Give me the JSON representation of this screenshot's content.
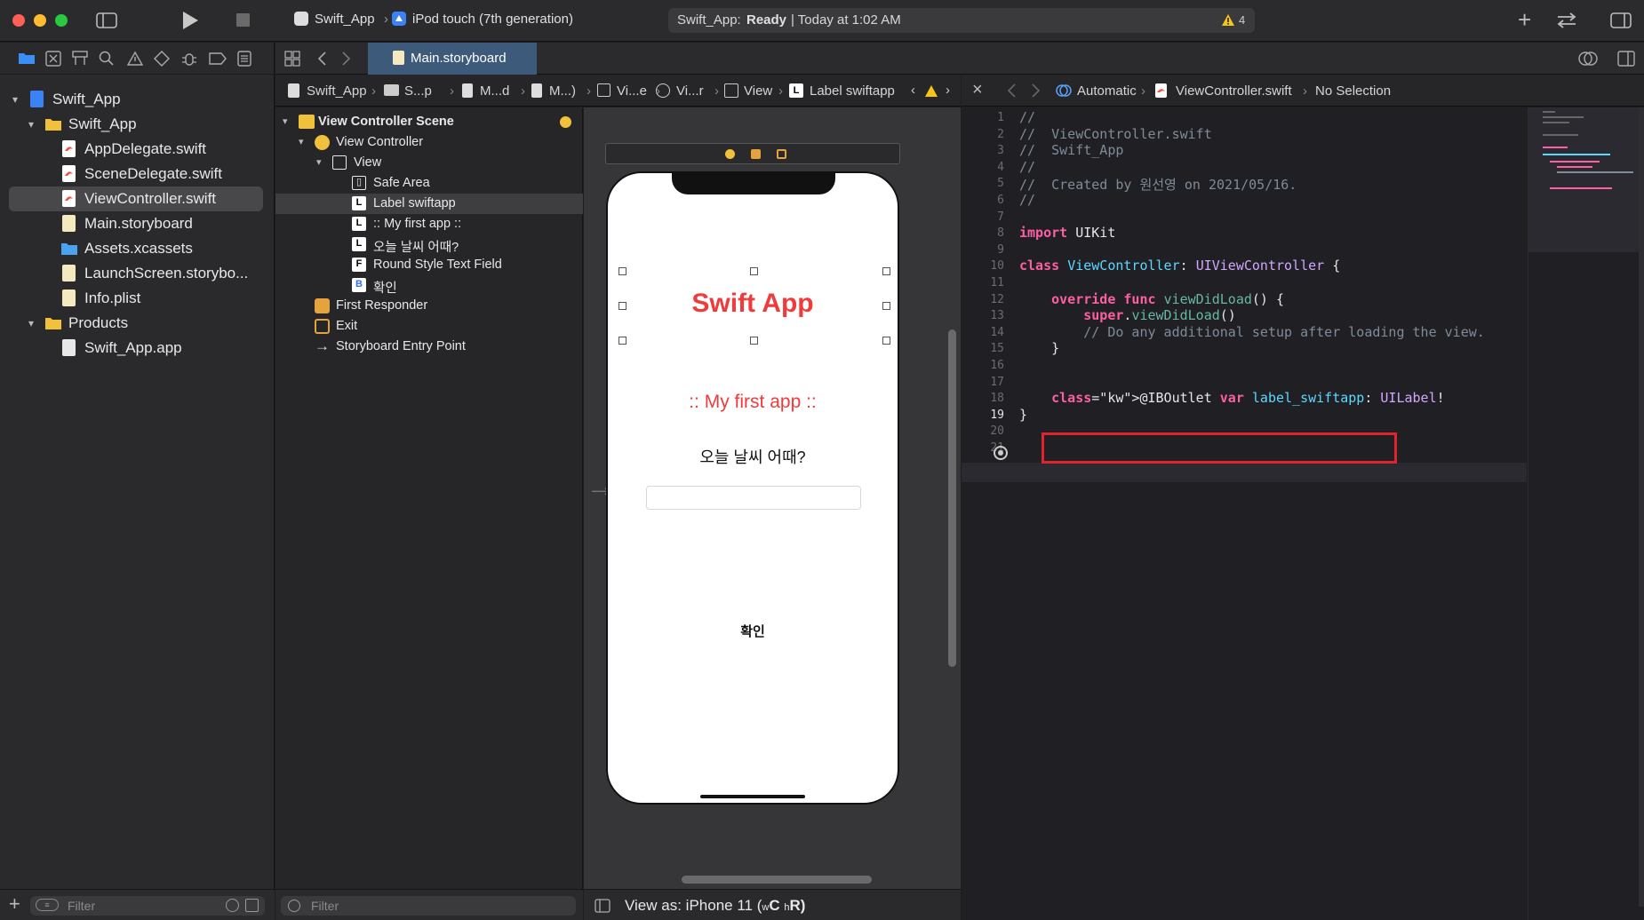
{
  "toolbar": {
    "scheme": "Swift_App",
    "device": "iPod touch (7th generation)",
    "status_app": "Swift_App:",
    "status_state": "Ready",
    "status_time": "| Today at 1:02 AM",
    "warning_count": "4"
  },
  "navigator": {
    "items": [
      {
        "label": "Swift_App",
        "kind": "project"
      },
      {
        "label": "Swift_App",
        "kind": "folder"
      },
      {
        "label": "AppDelegate.swift",
        "kind": "swift"
      },
      {
        "label": "SceneDelegate.swift",
        "kind": "swift"
      },
      {
        "label": "ViewController.swift",
        "kind": "swift",
        "selected": true
      },
      {
        "label": "Main.storyboard",
        "kind": "storyboard"
      },
      {
        "label": "Assets.xcassets",
        "kind": "assets"
      },
      {
        "label": "LaunchScreen.storybo...",
        "kind": "storyboard"
      },
      {
        "label": "Info.plist",
        "kind": "plist"
      },
      {
        "label": "Products",
        "kind": "folder"
      },
      {
        "label": "Swift_App.app",
        "kind": "app"
      }
    ],
    "filter_placeholder": "Filter"
  },
  "tabs": {
    "main_tab": "Main.storyboard"
  },
  "jumpbar_left": {
    "items": [
      "Swift_App",
      "S...p",
      "M...d",
      "M...)",
      "Vi...e",
      "Vi...r",
      "View",
      "Label swiftapp"
    ]
  },
  "jumpbar_right": {
    "mode": "Automatic",
    "file": "ViewController.swift",
    "selection": "No Selection"
  },
  "outline": {
    "scene": "View Controller Scene",
    "items": [
      {
        "label": "View Controller",
        "icon": "vc"
      },
      {
        "label": "View",
        "icon": "view"
      },
      {
        "label": "Safe Area",
        "icon": "safe"
      },
      {
        "label": "Label swiftapp",
        "icon": "L",
        "selected": true
      },
      {
        "label": ":: My first app ::",
        "icon": "L"
      },
      {
        "label": "오늘 날씨 어때?",
        "icon": "L"
      },
      {
        "label": "Round Style Text Field",
        "icon": "F"
      },
      {
        "label": "확인",
        "icon": "B"
      },
      {
        "label": "First Responder",
        "icon": "fr"
      },
      {
        "label": "Exit",
        "icon": "exit"
      },
      {
        "label": "Storyboard Entry Point",
        "icon": "arrow"
      }
    ],
    "filter_placeholder": "Filter"
  },
  "canvas": {
    "title_label": "Swift App",
    "subtitle_label": ":: My first app ::",
    "question_label": "오늘 날씨 어때?",
    "button_label": "확인",
    "view_as": "View as: iPhone 11 (",
    "view_as_w": "w",
    "view_as_c": "C",
    "view_as_h": "h",
    "view_as_r": "R)"
  },
  "code": {
    "current_line": 19,
    "lines": [
      "//",
      "//  ViewController.swift",
      "//  Swift_App",
      "//",
      "//  Created by 원선영 on 2021/05/16.",
      "//",
      "",
      "import UIKit",
      "",
      "class ViewController: UIViewController {",
      "",
      "    override func viewDidLoad() {",
      "        super.viewDidLoad()",
      "        // Do any additional setup after loading the view.",
      "    }",
      "",
      "",
      "    @IBOutlet var label_swiftapp: UILabel!",
      "}",
      "",
      ""
    ]
  },
  "colors": {
    "accent": "#3d5a7a",
    "highlight_box": "#e0242b",
    "title_red": "#ef3b3b"
  }
}
